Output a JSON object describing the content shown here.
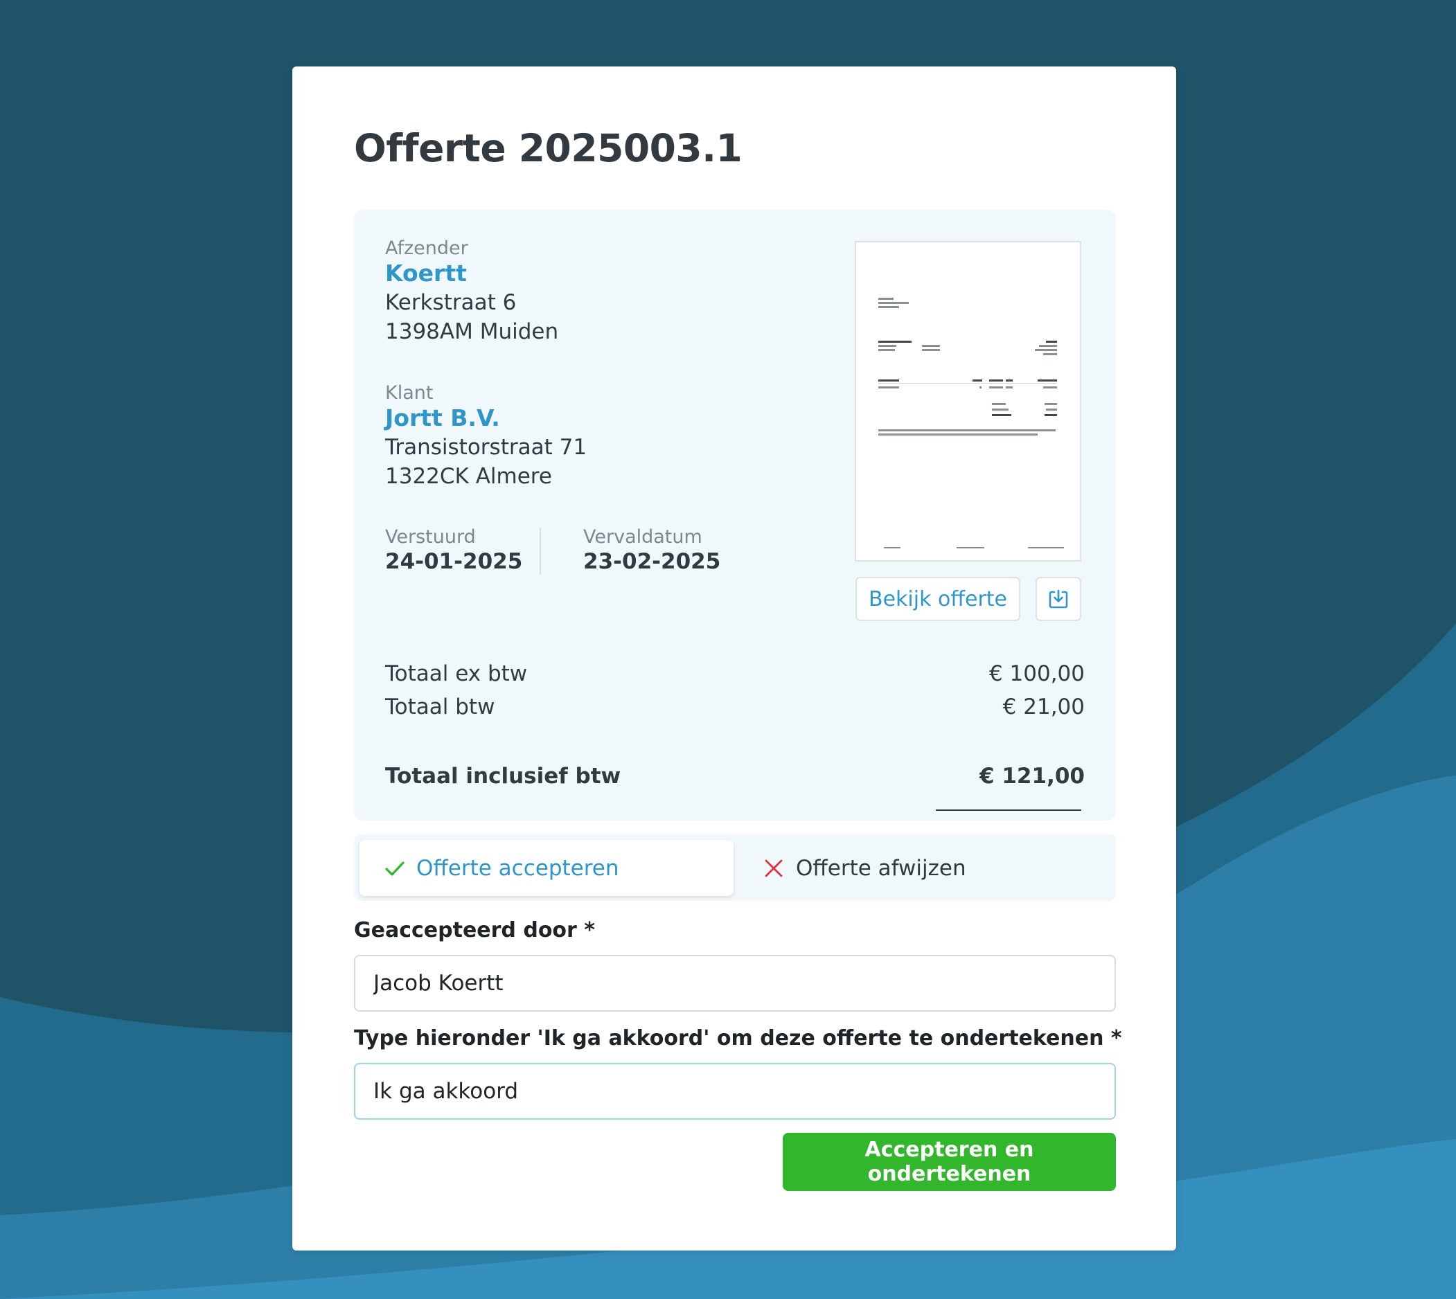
{
  "quote": {
    "title": "Offerte 2025003.1"
  },
  "sender": {
    "label": "Afzender",
    "name": "Koertt",
    "address_line1": "Kerkstraat 6",
    "address_line2": "1398AM Muiden"
  },
  "client": {
    "label": "Klant",
    "name": "Jortt B.V.",
    "address_line1": "Transistorstraat 71",
    "address_line2": "1322CK Almere"
  },
  "dates": {
    "sent_label": "Verstuurd",
    "sent_value": "24-01-2025",
    "due_label": "Vervaldatum",
    "due_value": "23-02-2025"
  },
  "preview": {
    "view_button": "Bekijk offerte",
    "download_icon": "download-icon"
  },
  "totals": {
    "ex_vat_label": "Totaal ex btw",
    "ex_vat_value": "€ 100,00",
    "vat_label": "Totaal btw",
    "vat_value": "€ 21,00",
    "incl_vat_label": "Totaal inclusief btw",
    "incl_vat_value": "€ 121,00"
  },
  "tabs": {
    "accept_label": "Offerte accepteren",
    "accept_icon": "check-icon",
    "reject_label": "Offerte afwijzen",
    "reject_icon": "x-icon",
    "active": "accept"
  },
  "form": {
    "accepted_by_label": "Geaccepteerd door *",
    "accepted_by_value": "Jacob Koertt",
    "sign_label": "Type hieronder 'Ik ga akkoord' om deze offerte te ondertekenen *",
    "sign_value": "Ik ga akkoord",
    "submit_label": "Accepteren en ondertekenen"
  },
  "colors": {
    "background_dark": "#1f5468",
    "wave_mid": "#236b8c",
    "wave_light": "#2f88b5",
    "accent_blue": "#2f96c9",
    "submit_green": "#32b72c",
    "check_green": "#32b72c",
    "reject_red": "#e0323a",
    "panel_bg": "#f1f8fc"
  }
}
